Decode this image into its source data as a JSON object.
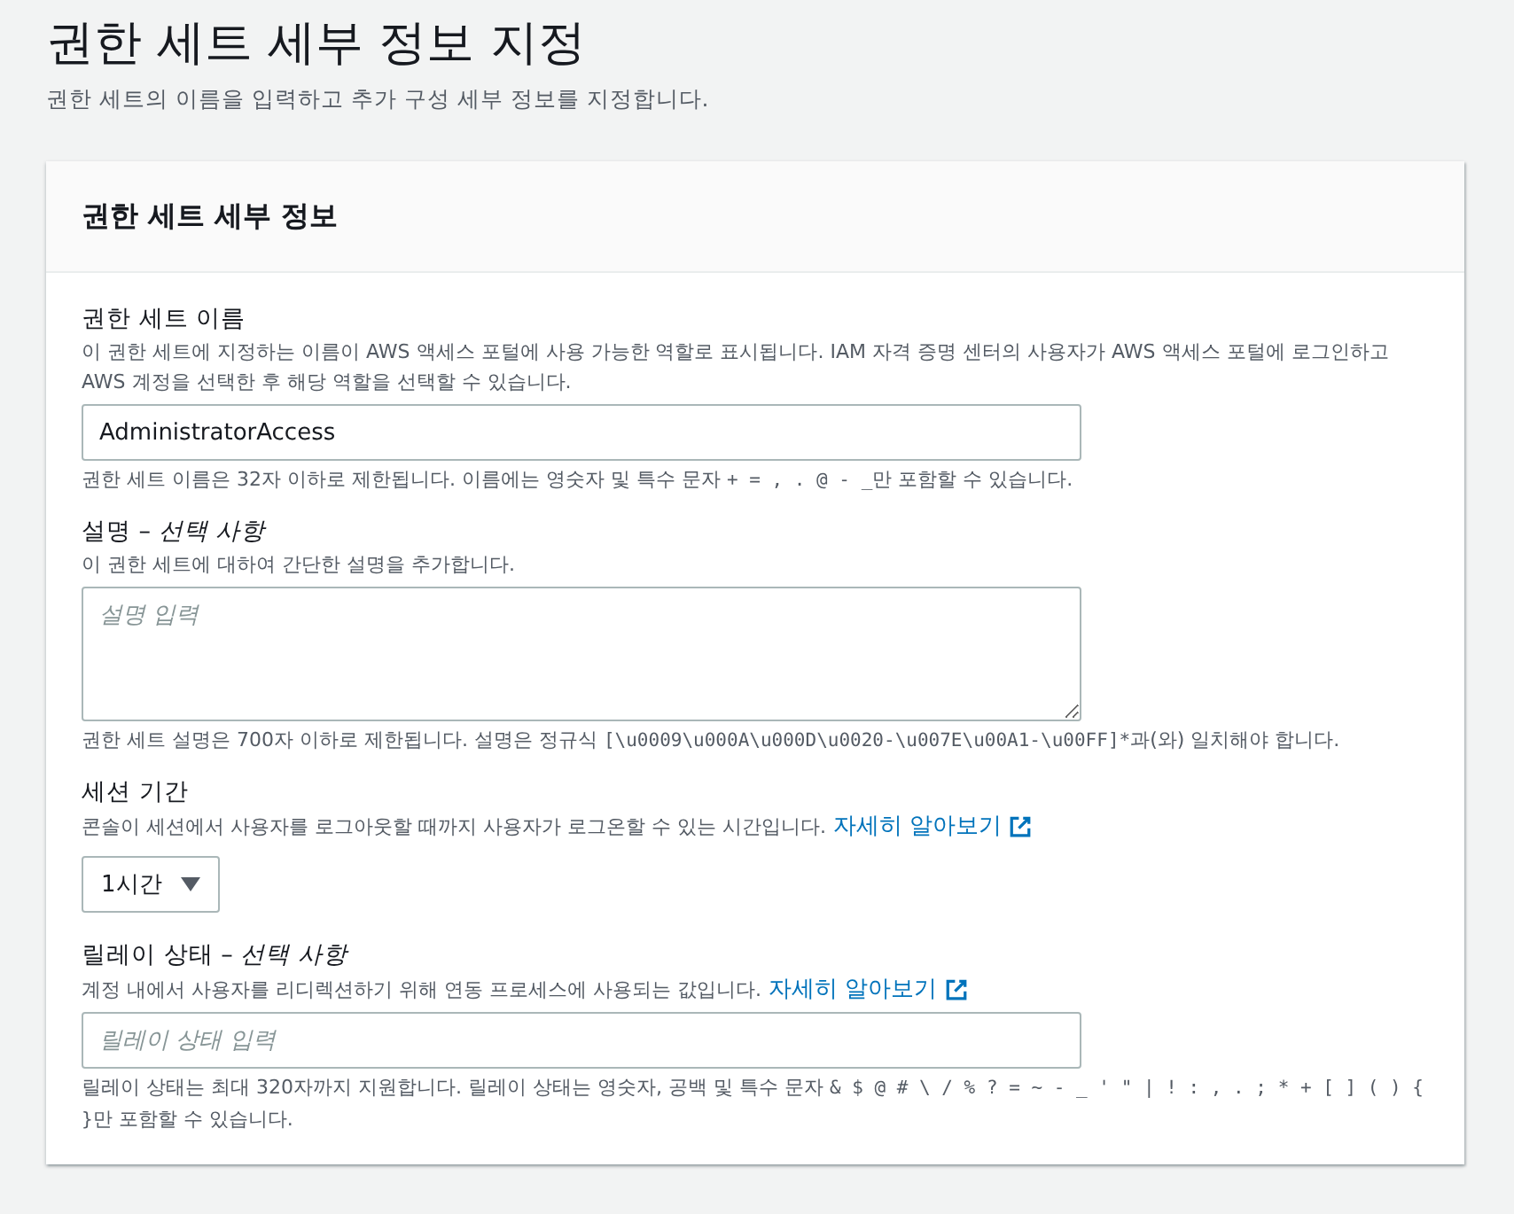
{
  "page": {
    "title": "권한 세트 세부 정보 지정",
    "subtitle": "권한 세트의 이름을 입력하고 추가 구성 세부 정보를 지정합니다."
  },
  "panel": {
    "title": "권한 세트 세부 정보",
    "fields": [
      {
        "kind": "text",
        "label": "권한 세트 이름",
        "description": "이 권한 세트에 지정하는 이름이 AWS 액세스 포털에 사용 가능한 역할로 표시됩니다. IAM 자격 증명 센터의 사용자가 AWS 액세스 포털에 로그인하고 AWS 계정을 선택한 후 해당 역할을 선택할 수 있습니다.",
        "value": "AdministratorAccess",
        "constraint": [
          {
            "kind": "plain",
            "text": "권한 세트 이름은 32자 이하로 제한됩니다. 이름에는 영숫자 및 특수 문자 "
          },
          {
            "kind": "code",
            "text": "+ = , . @ - _"
          },
          {
            "kind": "plain",
            "text": "만 포함할 수 있습니다."
          }
        ]
      },
      {
        "kind": "textarea",
        "label": "설명 – *선택 사항*",
        "description": "이 권한 세트에 대하여 간단한 설명을 추가합니다.",
        "placeholder": "설명 입력",
        "constraint": [
          {
            "kind": "plain",
            "text": "권한 세트 설명은 700자 이하로 제한됩니다. 설명은 정규식 "
          },
          {
            "kind": "code",
            "text": "[\\u0009\\u000A\\u000D\\u0020-\\u007E\\u00A1-\\u00FF]*"
          },
          {
            "kind": "plain",
            "text": "과(와) 일치해야 합니다."
          }
        ]
      },
      {
        "kind": "select",
        "label": "세션 기간",
        "description": "콘솔이 세션에서 사용자를 로그아웃할 때까지 사용자가 로그온할 수 있는 시간입니다.",
        "link": "자세히 알아보기",
        "value": "1시간"
      },
      {
        "kind": "text",
        "label": "릴레이 상태 – *선택 사항*",
        "description": "계정 내에서 사용자를 리디렉션하기 위해 연동 프로세스에 사용되는 값입니다.",
        "link": "자세히 알아보기",
        "placeholder": "릴레이 상태 입력",
        "constraint": [
          {
            "kind": "plain",
            "text": "릴레이 상태는 최대 320자까지 지원합니다. 릴레이 상태는 영숫자, 공백 및 특수 문자 "
          },
          {
            "kind": "code",
            "text": "& $ @ # \\ / % ? = ~ - _ ' \" | ! : , . ; * + [ ] ( ) { }"
          },
          {
            "kind": "plain",
            "text": "만 포함할 수 있습니다."
          }
        ]
      }
    ]
  }
}
